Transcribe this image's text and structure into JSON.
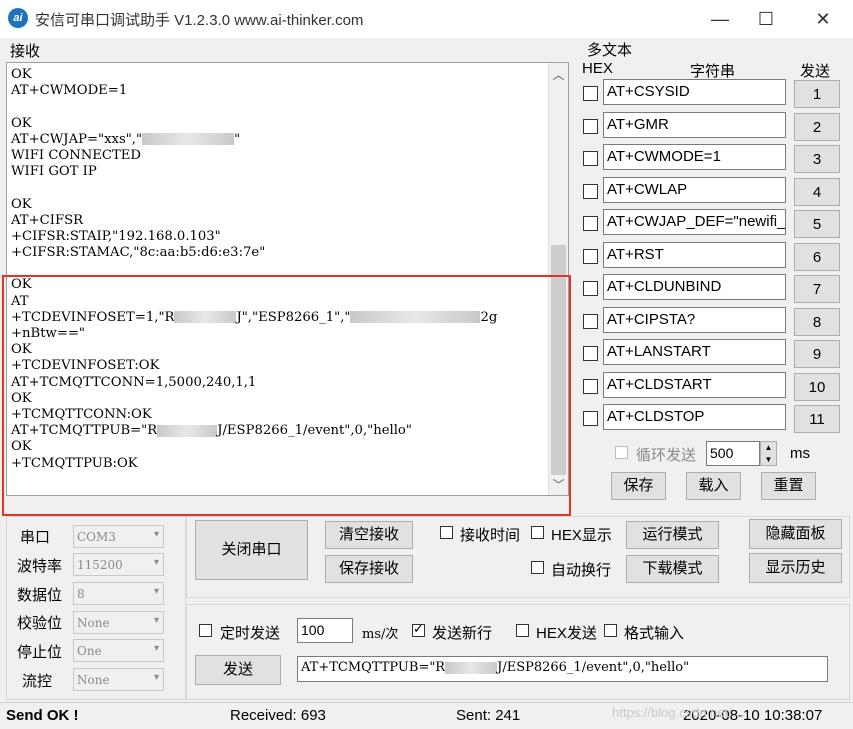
{
  "window": {
    "app_icon": "ai",
    "title": "安信可串口调试助手 V1.2.3.0    www.ai-thinker.com",
    "controls": {
      "minimize": "—",
      "maximize": "☐",
      "close": "✕"
    }
  },
  "receive": {
    "label": "接收",
    "lines": [
      "OK",
      "AT+CWMODE=1",
      "",
      "OK",
      "AT+CWJAP=\"xxs\",\"",
      "WIFI CONNECTED",
      "WIFI GOT IP",
      "",
      "OK",
      "AT+CIFSR",
      "+CIFSR:STAIP,\"192.168.0.103\"",
      "+CIFSR:STAMAC,\"8c:aa:b5:d6:e3:7e\"",
      "",
      "OK",
      "AT",
      "+TCDEVINFOSET=1,\"R",
      "+nBtw==\"",
      "OK",
      "+TCDEVINFOSET:OK",
      "AT+TCMQTTCONN=1,5000,240,1,1",
      "OK",
      "+TCMQTTCONN:OK",
      "AT+TCMQTTPUB=\"R",
      "OK",
      "+TCMQTTPUB:OK"
    ],
    "line_tails": {
      "4": "\"",
      "15": "J\",\"ESP8266_1\",\"",
      "22": "J/ESP8266_1/event\",0,\"hello\""
    },
    "line15_end": "2g"
  },
  "multi": {
    "title": "多文本",
    "headers": {
      "hex": "HEX",
      "string": "字符串",
      "send": "发送"
    },
    "rows": [
      {
        "text": "AT+CSYSID",
        "num": "1"
      },
      {
        "text": "AT+GMR",
        "num": "2"
      },
      {
        "text": "AT+CWMODE=1",
        "num": "3"
      },
      {
        "text": "AT+CWLAP",
        "num": "4"
      },
      {
        "text": "AT+CWJAP_DEF=\"newifi_",
        "num": "5"
      },
      {
        "text": "AT+RST",
        "num": "6"
      },
      {
        "text": "AT+CLDUNBIND",
        "num": "7"
      },
      {
        "text": "AT+CIPSTA?",
        "num": "8"
      },
      {
        "text": "AT+LANSTART",
        "num": "9"
      },
      {
        "text": "AT+CLDSTART",
        "num": "10"
      },
      {
        "text": "AT+CLDSTOP",
        "num": "11"
      }
    ],
    "loop_send": "循环发送",
    "interval": "500",
    "ms": "ms",
    "save": "保存",
    "load": "载入",
    "reset": "重置"
  },
  "serial": {
    "port_label": "串口",
    "port": "COM3",
    "baud_label": "波特率",
    "baud": "115200",
    "data_label": "数据位",
    "data": "8",
    "parity_label": "校验位",
    "parity": "None",
    "stop_label": "停止位",
    "stop": "One",
    "flow_label": "流控",
    "flow": "None",
    "close_port": "关闭串口"
  },
  "options": {
    "clear_recv": "清空接收",
    "save_recv": "保存接收",
    "recv_time": "接收时间",
    "hex_display": "HEX显示",
    "run_mode": "运行模式",
    "hide_panel": "隐藏面板",
    "auto_wrap": "自动换行",
    "download_mode": "下载模式",
    "show_history": "显示历史"
  },
  "send": {
    "timed_send": "定时发送",
    "period": "100",
    "period_unit": "ms/次",
    "newline": "发送新行",
    "hex_send": "HEX发送",
    "format_input": "格式输入",
    "send_button": "发送",
    "input_prefix": "AT+TCMQTTPUB=\"R",
    "input_suffix": "J/ESP8266_1/event\",0,\"hello\""
  },
  "status": {
    "send_ok": "Send OK !",
    "received": "Received: 693",
    "sent": "Sent: 241",
    "datetime": "2020-08-10 10:38:07",
    "watermark": "https://blog.csdn.net/..."
  }
}
